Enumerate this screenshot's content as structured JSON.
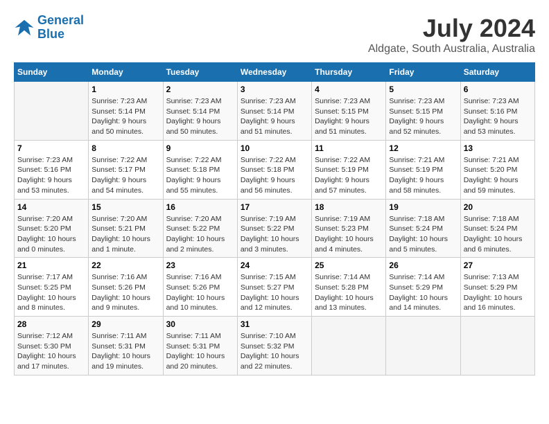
{
  "logo": {
    "line1": "General",
    "line2": "Blue"
  },
  "title": "July 2024",
  "location": "Aldgate, South Australia, Australia",
  "days_of_week": [
    "Sunday",
    "Monday",
    "Tuesday",
    "Wednesday",
    "Thursday",
    "Friday",
    "Saturday"
  ],
  "weeks": [
    [
      {
        "num": "",
        "info": ""
      },
      {
        "num": "1",
        "info": "Sunrise: 7:23 AM\nSunset: 5:14 PM\nDaylight: 9 hours\nand 50 minutes."
      },
      {
        "num": "2",
        "info": "Sunrise: 7:23 AM\nSunset: 5:14 PM\nDaylight: 9 hours\nand 50 minutes."
      },
      {
        "num": "3",
        "info": "Sunrise: 7:23 AM\nSunset: 5:14 PM\nDaylight: 9 hours\nand 51 minutes."
      },
      {
        "num": "4",
        "info": "Sunrise: 7:23 AM\nSunset: 5:15 PM\nDaylight: 9 hours\nand 51 minutes."
      },
      {
        "num": "5",
        "info": "Sunrise: 7:23 AM\nSunset: 5:15 PM\nDaylight: 9 hours\nand 52 minutes."
      },
      {
        "num": "6",
        "info": "Sunrise: 7:23 AM\nSunset: 5:16 PM\nDaylight: 9 hours\nand 53 minutes."
      }
    ],
    [
      {
        "num": "7",
        "info": "Sunrise: 7:23 AM\nSunset: 5:16 PM\nDaylight: 9 hours\nand 53 minutes."
      },
      {
        "num": "8",
        "info": "Sunrise: 7:22 AM\nSunset: 5:17 PM\nDaylight: 9 hours\nand 54 minutes."
      },
      {
        "num": "9",
        "info": "Sunrise: 7:22 AM\nSunset: 5:18 PM\nDaylight: 9 hours\nand 55 minutes."
      },
      {
        "num": "10",
        "info": "Sunrise: 7:22 AM\nSunset: 5:18 PM\nDaylight: 9 hours\nand 56 minutes."
      },
      {
        "num": "11",
        "info": "Sunrise: 7:22 AM\nSunset: 5:19 PM\nDaylight: 9 hours\nand 57 minutes."
      },
      {
        "num": "12",
        "info": "Sunrise: 7:21 AM\nSunset: 5:19 PM\nDaylight: 9 hours\nand 58 minutes."
      },
      {
        "num": "13",
        "info": "Sunrise: 7:21 AM\nSunset: 5:20 PM\nDaylight: 9 hours\nand 59 minutes."
      }
    ],
    [
      {
        "num": "14",
        "info": "Sunrise: 7:20 AM\nSunset: 5:20 PM\nDaylight: 10 hours\nand 0 minutes."
      },
      {
        "num": "15",
        "info": "Sunrise: 7:20 AM\nSunset: 5:21 PM\nDaylight: 10 hours\nand 1 minute."
      },
      {
        "num": "16",
        "info": "Sunrise: 7:20 AM\nSunset: 5:22 PM\nDaylight: 10 hours\nand 2 minutes."
      },
      {
        "num": "17",
        "info": "Sunrise: 7:19 AM\nSunset: 5:22 PM\nDaylight: 10 hours\nand 3 minutes."
      },
      {
        "num": "18",
        "info": "Sunrise: 7:19 AM\nSunset: 5:23 PM\nDaylight: 10 hours\nand 4 minutes."
      },
      {
        "num": "19",
        "info": "Sunrise: 7:18 AM\nSunset: 5:24 PM\nDaylight: 10 hours\nand 5 minutes."
      },
      {
        "num": "20",
        "info": "Sunrise: 7:18 AM\nSunset: 5:24 PM\nDaylight: 10 hours\nand 6 minutes."
      }
    ],
    [
      {
        "num": "21",
        "info": "Sunrise: 7:17 AM\nSunset: 5:25 PM\nDaylight: 10 hours\nand 8 minutes."
      },
      {
        "num": "22",
        "info": "Sunrise: 7:16 AM\nSunset: 5:26 PM\nDaylight: 10 hours\nand 9 minutes."
      },
      {
        "num": "23",
        "info": "Sunrise: 7:16 AM\nSunset: 5:26 PM\nDaylight: 10 hours\nand 10 minutes."
      },
      {
        "num": "24",
        "info": "Sunrise: 7:15 AM\nSunset: 5:27 PM\nDaylight: 10 hours\nand 12 minutes."
      },
      {
        "num": "25",
        "info": "Sunrise: 7:14 AM\nSunset: 5:28 PM\nDaylight: 10 hours\nand 13 minutes."
      },
      {
        "num": "26",
        "info": "Sunrise: 7:14 AM\nSunset: 5:29 PM\nDaylight: 10 hours\nand 14 minutes."
      },
      {
        "num": "27",
        "info": "Sunrise: 7:13 AM\nSunset: 5:29 PM\nDaylight: 10 hours\nand 16 minutes."
      }
    ],
    [
      {
        "num": "28",
        "info": "Sunrise: 7:12 AM\nSunset: 5:30 PM\nDaylight: 10 hours\nand 17 minutes."
      },
      {
        "num": "29",
        "info": "Sunrise: 7:11 AM\nSunset: 5:31 PM\nDaylight: 10 hours\nand 19 minutes."
      },
      {
        "num": "30",
        "info": "Sunrise: 7:11 AM\nSunset: 5:31 PM\nDaylight: 10 hours\nand 20 minutes."
      },
      {
        "num": "31",
        "info": "Sunrise: 7:10 AM\nSunset: 5:32 PM\nDaylight: 10 hours\nand 22 minutes."
      },
      {
        "num": "",
        "info": ""
      },
      {
        "num": "",
        "info": ""
      },
      {
        "num": "",
        "info": ""
      }
    ]
  ]
}
